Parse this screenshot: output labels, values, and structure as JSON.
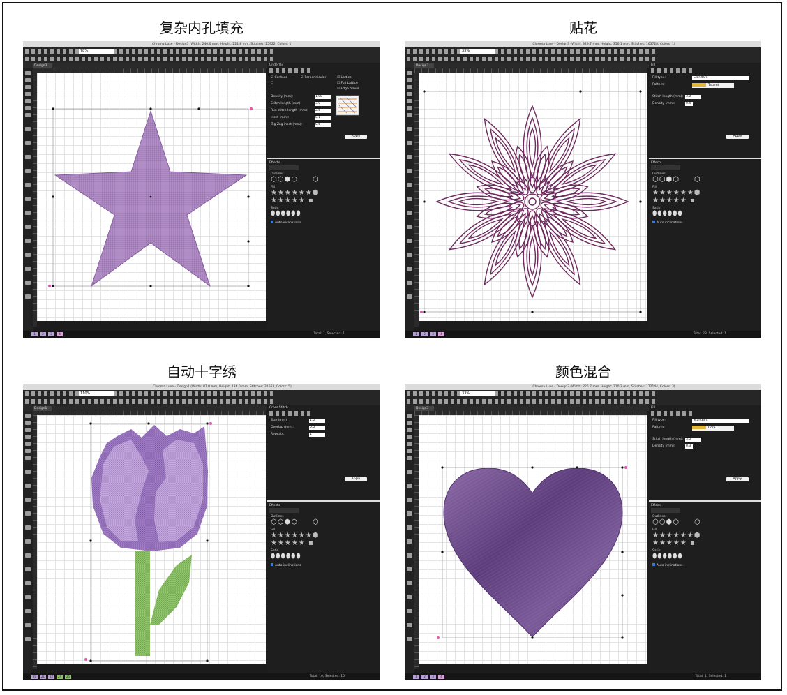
{
  "captions": {
    "tl": "复杂内孔填充",
    "tr": "贴花",
    "bl": "自动十字绣",
    "br": "颜色混合"
  },
  "screens": {
    "tl": {
      "window_title": "Chroma Luxe - Design3 (Width: 240.0 mm, Height: 221.8 mm, Stitches: 25922, Colors: 1)",
      "zoom": "78%",
      "tab": "Design3",
      "panel_title": "Underlay",
      "checkboxes": [
        "Contour",
        "Perpendicular",
        "Lattice",
        "Full Lattice",
        "Edge travel"
      ],
      "fields": [
        {
          "label": "Density (mm):",
          "value": "1.00"
        },
        {
          "label": "Stitch length (mm):",
          "value": "3.0"
        },
        {
          "label": "Run stitch length (mm):",
          "value": "2.5"
        },
        {
          "label": "Inset (mm):",
          "value": "0.1"
        },
        {
          "label": "Zig-Zag inset (mm):",
          "value": "0.6"
        }
      ],
      "apply": "Apply",
      "status": "Total: 1, Selected: 1",
      "pages": [
        "1",
        "2",
        "3",
        "4"
      ]
    },
    "tr": {
      "window_title": "Chroma Luxe - Design3 (Width: 329.7 mm, Height: 356.1 mm, Stitches: 163728, Colors: 1)",
      "zoom": "33%",
      "tab": "Design3",
      "panel_title": "Fill",
      "fill_type_label": "Fill type:",
      "fill_type": "Standard",
      "pattern_label": "Pattern:",
      "pattern": "Tatami",
      "fields": [
        {
          "label": "Stitch length (mm):",
          "value": "3.0"
        },
        {
          "label": "Density (mm):",
          "value": "0.4"
        }
      ],
      "apply": "Apply",
      "status": "Total: 28, Selected: 1",
      "pages": [
        "1",
        "2",
        "3",
        "4"
      ]
    },
    "bl": {
      "window_title": "Chroma Luxe - Design1 (Width: 87.0 mm, Height: 136.0 mm, Stitches: 31663, Colors: 5)",
      "zoom": "110%",
      "tab": "Design1",
      "panel_title": "Cross Stitch",
      "fields": [
        {
          "label": "Size (mm):",
          "value": "1.0"
        },
        {
          "label": "Overlap (mm):",
          "value": "0.0"
        },
        {
          "label": "Repeats:",
          "value": "1"
        }
      ],
      "apply": "Apply",
      "status": "Total: 10, Selected: 10",
      "pages": [
        "20",
        "21",
        "22",
        "24",
        "25"
      ]
    },
    "br": {
      "window_title": "Chroma Luxe - Design3 (Width: 225.7 mm, Height: 210.2 mm, Stitches: 172144, Colors: 3)",
      "zoom": "33%",
      "tab": "Design3",
      "panel_title": "Fill",
      "fill_type_label": "Fill type:",
      "fill_type": "Standard",
      "pattern_label": "Pattern:",
      "pattern": "Cora",
      "fields": [
        {
          "label": "Stitch length (mm):",
          "value": "3.0"
        },
        {
          "label": "Density (mm):",
          "value": "0.3"
        }
      ],
      "apply": "Apply",
      "status": "Total: 1, Selected: 1",
      "pages": [
        "1",
        "2",
        "3",
        "4"
      ]
    }
  },
  "effects": {
    "title": "Effects",
    "outlines": "Outlines",
    "fill": "Fill",
    "satin": "Satin",
    "auto_inclinations": "Auto inclinations"
  },
  "colors": {
    "star_fill": "#b08ec3",
    "mandala_stroke": "#6e2a5e",
    "tulip_light": "#c3a6db",
    "tulip_dark": "#9f7bc4",
    "stem": "#8fc46a",
    "heart": "#6d4a8a"
  }
}
